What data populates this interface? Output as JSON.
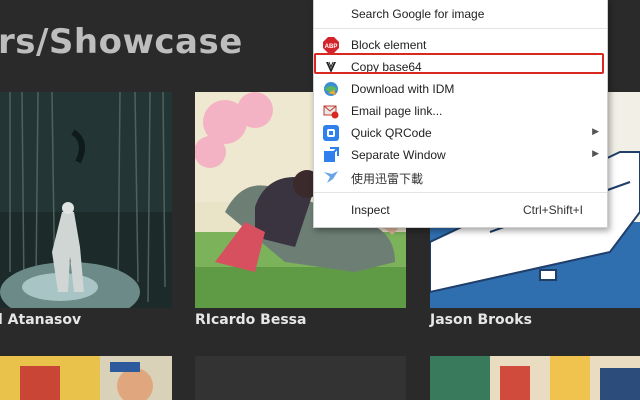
{
  "page": {
    "title": "rs/Showcase"
  },
  "cards": [
    {
      "caption": "l Atanasov"
    },
    {
      "caption": "RIcardo Bessa"
    },
    {
      "caption": "Jason Brooks"
    }
  ],
  "context_menu": {
    "search_google_image": "Search Google for image",
    "block_element": "Block element",
    "copy_base64": "Copy base64",
    "download_idm": "Download with IDM",
    "email_page_link": "Email page link...",
    "quick_qrcode": "Quick QRCode",
    "separate_window": "Separate Window",
    "xunlei_download": "使用迅雷下載",
    "inspect": "Inspect",
    "inspect_shortcut": "Ctrl+Shift+I",
    "submenu_arrow": "▶",
    "abp_icon_text": "ABP"
  },
  "colors": {
    "highlight": "#d9281f",
    "page_bg": "#2a2a2a"
  }
}
